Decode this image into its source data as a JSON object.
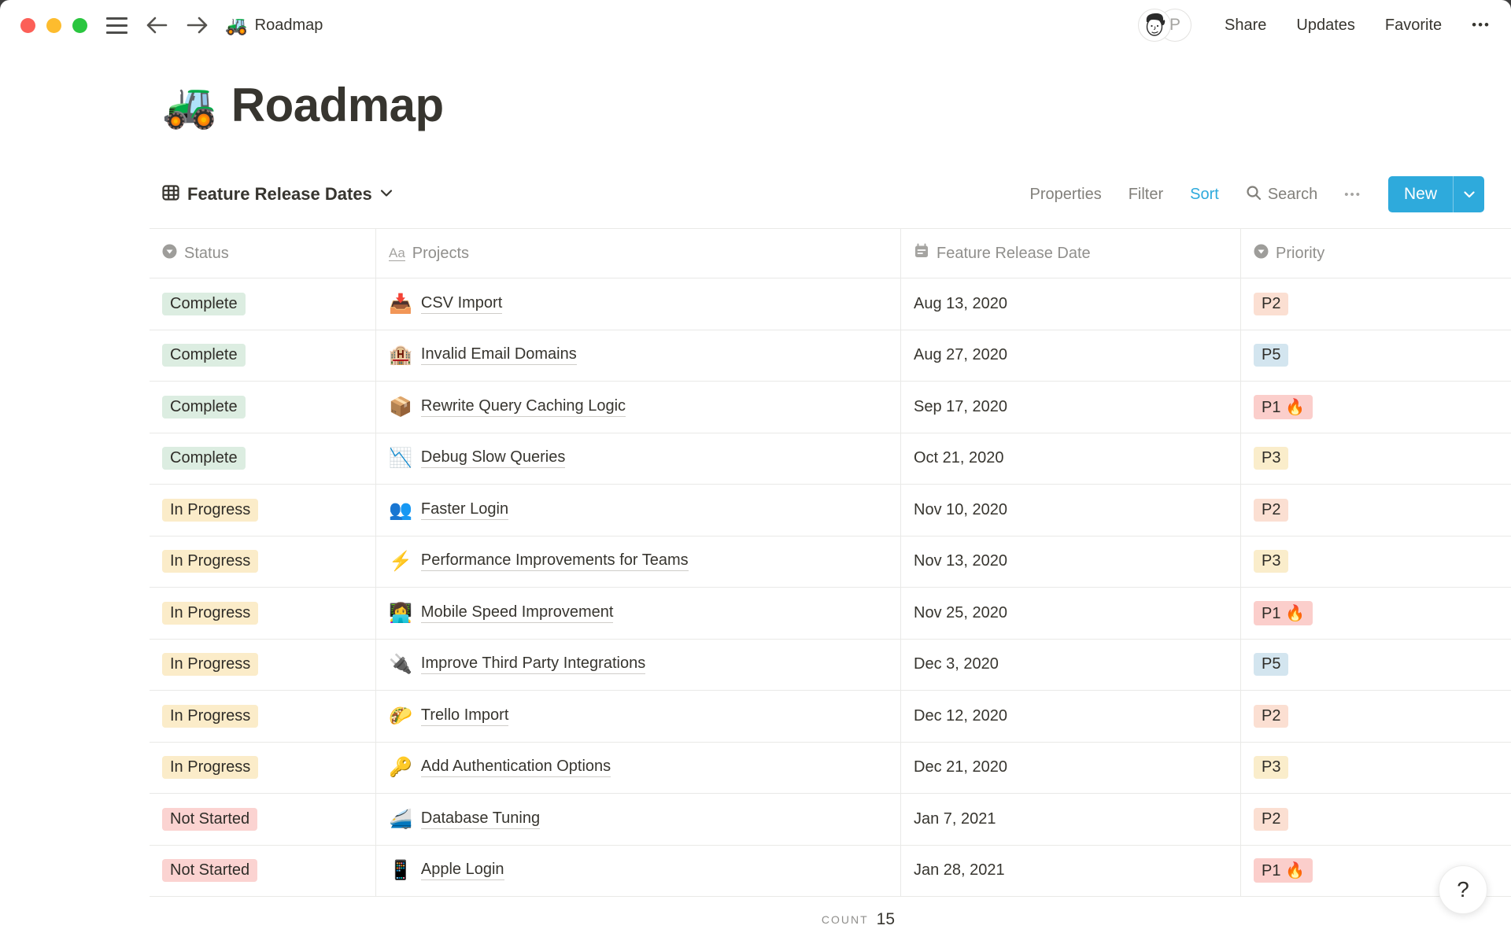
{
  "titlebar": {
    "doc_icon": "🚜",
    "doc_title": "Roadmap",
    "share": "Share",
    "updates": "Updates",
    "favorite": "Favorite",
    "more": "•••",
    "avatar_initial": "P"
  },
  "page": {
    "emoji": "🚜",
    "title": "Roadmap"
  },
  "toolbar": {
    "view_name": "Feature Release Dates",
    "properties": "Properties",
    "filter": "Filter",
    "sort": "Sort",
    "search": "Search",
    "more": "•••",
    "new_label": "New"
  },
  "table": {
    "headers": {
      "status": "Status",
      "projects": "Projects",
      "projects_icon_glyph": "Aa",
      "date": "Feature Release Date",
      "priority": "Priority"
    },
    "rows": [
      {
        "status": "Complete",
        "status_key": "complete",
        "emoji": "📥",
        "project": "CSV Import",
        "date": "Aug 13, 2020",
        "priority": "P2",
        "priority_key": "p2"
      },
      {
        "status": "Complete",
        "status_key": "complete",
        "emoji": "🏨",
        "project": "Invalid Email Domains",
        "date": "Aug 27, 2020",
        "priority": "P5",
        "priority_key": "p5"
      },
      {
        "status": "Complete",
        "status_key": "complete",
        "emoji": "📦",
        "project": "Rewrite Query Caching Logic",
        "date": "Sep 17, 2020",
        "priority": "P1 🔥",
        "priority_key": "p1"
      },
      {
        "status": "Complete",
        "status_key": "complete",
        "emoji": "📉",
        "project": "Debug Slow Queries",
        "date": "Oct 21, 2020",
        "priority": "P3",
        "priority_key": "p3"
      },
      {
        "status": "In Progress",
        "status_key": "in-progress",
        "emoji": "👥",
        "project": "Faster Login",
        "date": "Nov 10, 2020",
        "priority": "P2",
        "priority_key": "p2"
      },
      {
        "status": "In Progress",
        "status_key": "in-progress",
        "emoji": "⚡",
        "project": "Performance Improvements for Teams",
        "date": "Nov 13, 2020",
        "priority": "P3",
        "priority_key": "p3"
      },
      {
        "status": "In Progress",
        "status_key": "in-progress",
        "emoji": "👩‍💻",
        "project": "Mobile Speed Improvement",
        "date": "Nov 25, 2020",
        "priority": "P1 🔥",
        "priority_key": "p1"
      },
      {
        "status": "In Progress",
        "status_key": "in-progress",
        "emoji": "🔌",
        "project": "Improve Third Party Integrations",
        "date": "Dec 3, 2020",
        "priority": "P5",
        "priority_key": "p5"
      },
      {
        "status": "In Progress",
        "status_key": "in-progress",
        "emoji": "🌮",
        "project": "Trello Import",
        "date": "Dec 12, 2020",
        "priority": "P2",
        "priority_key": "p2"
      },
      {
        "status": "In Progress",
        "status_key": "in-progress",
        "emoji": "🔑",
        "project": "Add Authentication Options",
        "date": "Dec 21, 2020",
        "priority": "P3",
        "priority_key": "p3"
      },
      {
        "status": "Not Started",
        "status_key": "not-started",
        "emoji": "🚄",
        "project": "Database Tuning",
        "date": "Jan 7, 2021",
        "priority": "P2",
        "priority_key": "p2"
      },
      {
        "status": "Not Started",
        "status_key": "not-started",
        "emoji": "📱",
        "project": "Apple Login",
        "date": "Jan 28, 2021",
        "priority": "P1 🔥",
        "priority_key": "p1"
      }
    ]
  },
  "badge_colors": {
    "complete": "#DCEDE1",
    "in-progress": "#FBECC9",
    "not-started": "#FBD3D1",
    "p1": "#FBCECB",
    "p2": "#FBDFD2",
    "p3": "#FAEDCB",
    "p5": "#D3E5EF"
  },
  "footer": {
    "count_label": "COUNT",
    "count_value": "15"
  },
  "help": {
    "label": "?"
  },
  "colors": {
    "accent_blue": "#2EAADC",
    "text": "#37352F",
    "muted": "#908F8C",
    "border": "#E9E9E7"
  }
}
